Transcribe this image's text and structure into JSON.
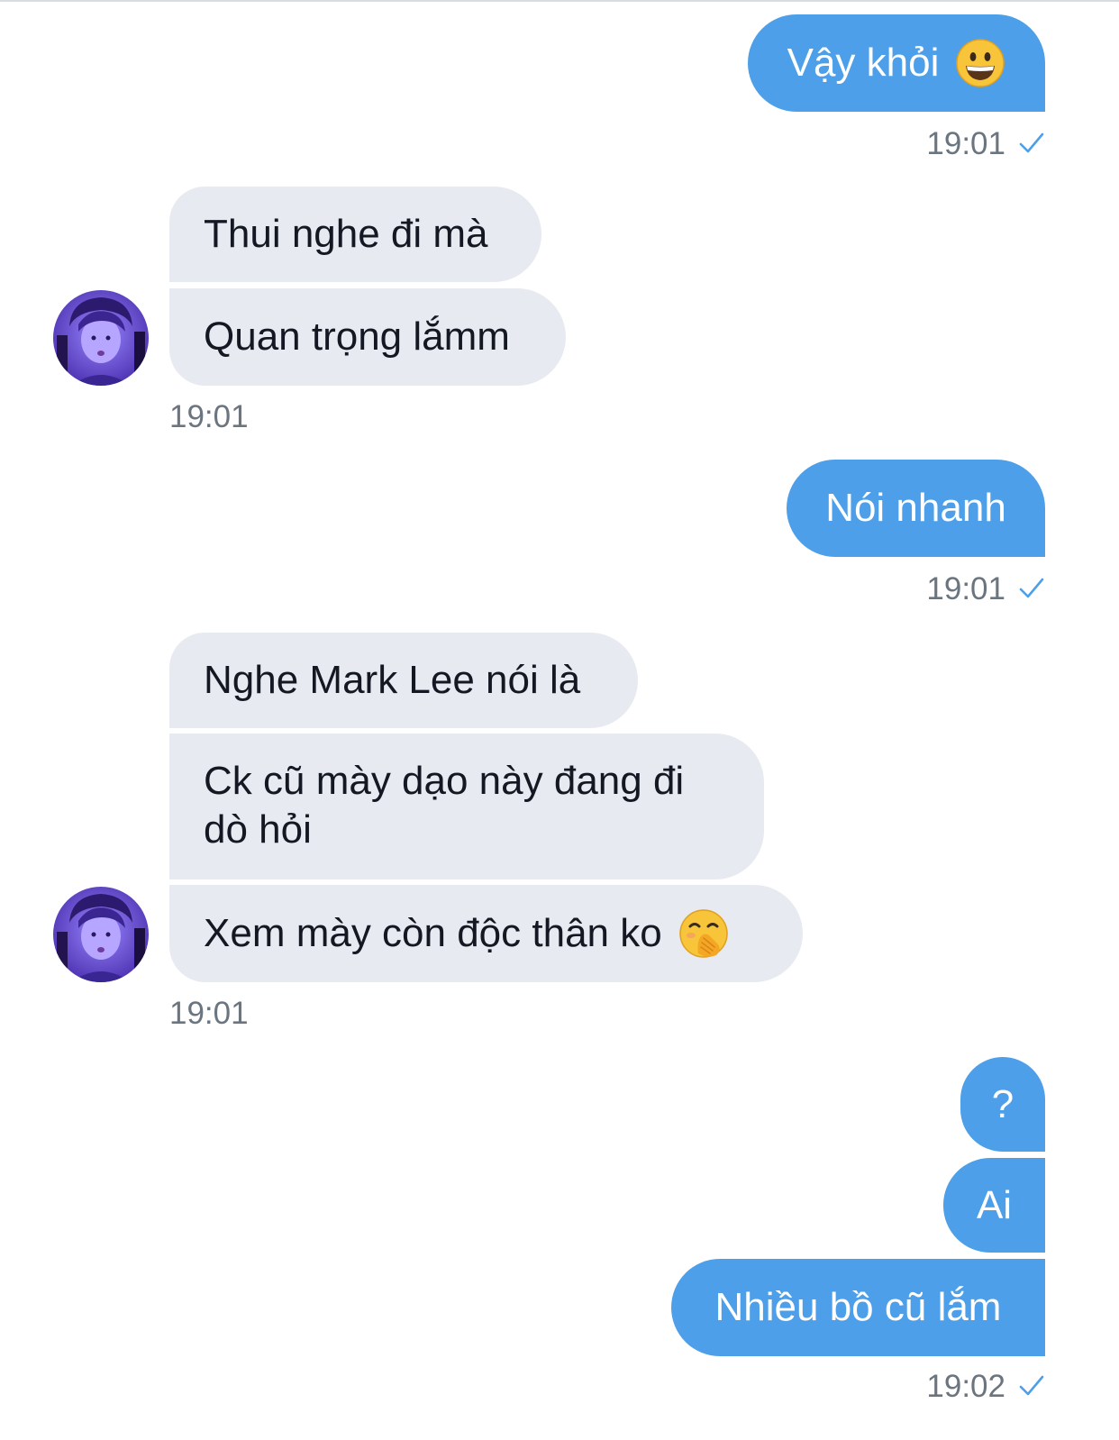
{
  "chat": {
    "messages": {
      "m1": {
        "text": "Vậy khỏi",
        "emoji": "grinning-face-emoji",
        "time": "19:01"
      },
      "m2": {
        "text": "Thui nghe đi mà"
      },
      "m3": {
        "text": "Quan trọng lắmm",
        "time": "19:01"
      },
      "m4": {
        "text": "Nói nhanh",
        "time": "19:01"
      },
      "m5": {
        "text": "Nghe Mark Lee nói là"
      },
      "m6": {
        "text": "Ck cũ mày dạo này đang đi dò hỏi"
      },
      "m7": {
        "text": "Xem mày còn độc thân ko",
        "emoji": "face-with-hand-over-mouth-emoji",
        "time": "19:01"
      },
      "m8": {
        "text": "?"
      },
      "m9": {
        "text": "Ai"
      },
      "m10": {
        "text": "Nhiều bồ cũ lắm",
        "time": "19:02"
      }
    },
    "colors": {
      "outgoing_bubble": "#4c9fe8",
      "incoming_bubble": "#e7eaf0",
      "read_check": "#4c9fe8",
      "timestamp": "#6b7580"
    }
  }
}
